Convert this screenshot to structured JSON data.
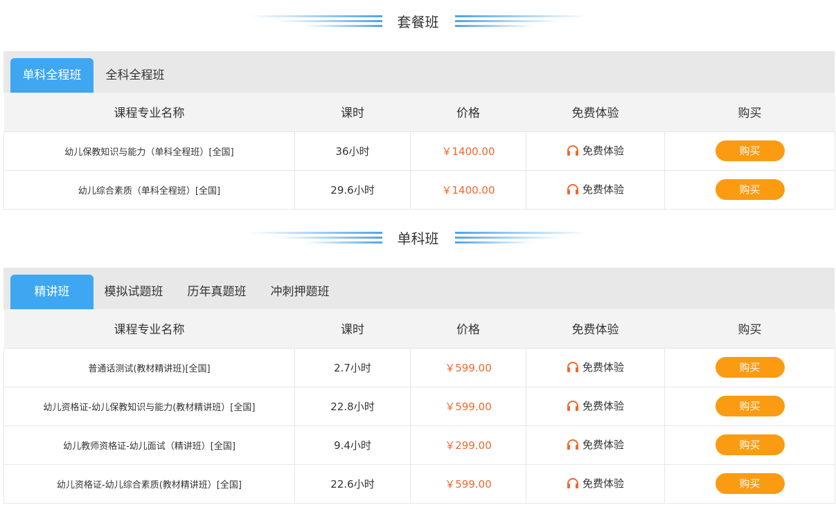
{
  "sections": [
    {
      "title": "套餐班",
      "tabs": [
        "单科全程班",
        "全科全程班"
      ],
      "headers": [
        "课程专业名称",
        "课时",
        "价格",
        "免费体验",
        "购买"
      ],
      "rows": [
        {
          "name": "幼儿保教知识与能力（单科全程班）[全国]",
          "hours": "36小时",
          "price": "￥1400.00",
          "trial": "免费体验",
          "buy": "购买"
        },
        {
          "name": "幼儿综合素质（单科全程班）[全国]",
          "hours": "29.6小时",
          "price": "￥1400.00",
          "trial": "免费体验",
          "buy": "购买"
        }
      ]
    },
    {
      "title": "单科班",
      "tabs": [
        "精讲班",
        "模拟试题班",
        "历年真题班",
        "冲刺押题班"
      ],
      "headers": [
        "课程专业名称",
        "课时",
        "价格",
        "免费体验",
        "购买"
      ],
      "rows": [
        {
          "name": "普通话测试(教材精讲班)[全国]",
          "hours": "2.7小时",
          "price": "￥599.00",
          "trial": "免费体验",
          "buy": "购买"
        },
        {
          "name": "幼儿资格证-幼儿保教知识与能力(教材精讲班）[全国]",
          "hours": "22.8小时",
          "price": "￥599.00",
          "trial": "免费体验",
          "buy": "购买"
        },
        {
          "name": "幼儿教师资格证-幼儿面试（精讲班）[全国]",
          "hours": "9.4小时",
          "price": "￥299.00",
          "trial": "免费体验",
          "buy": "购买"
        },
        {
          "name": "幼儿资格证-幼儿综合素质(教材精讲班）[全国]",
          "hours": "22.6小时",
          "price": "￥599.00",
          "trial": "免费体验",
          "buy": "购买"
        }
      ]
    }
  ],
  "colors": {
    "accent": "#3fa7f2",
    "buy": "#fb9b11",
    "price": "#f2672b",
    "icon": "#f2672b"
  },
  "icons": {
    "trial": "headphones-icon"
  }
}
